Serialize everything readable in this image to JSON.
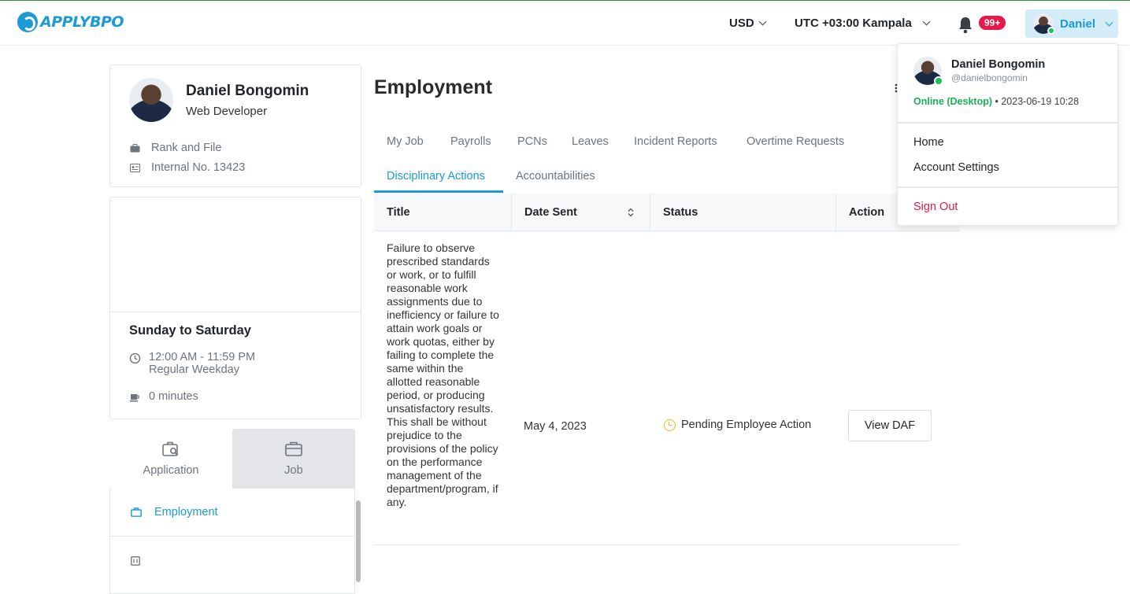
{
  "brand": {
    "name": "APPLYBPO",
    "accent": "#1a9ad6"
  },
  "topbar": {
    "currency": "USD",
    "timezone": "UTC +03:00 Kampala",
    "notifications_badge": "99+",
    "user_button": "Daniel"
  },
  "profile": {
    "name": "Daniel Bongomin",
    "role": "Web Developer",
    "rank": "Rank and File",
    "internal_no": "Internal No. 13423"
  },
  "schedule": {
    "days": "Sunday to Saturday",
    "time": "12:00 AM - 11:59 PM",
    "type": "Regular Weekday",
    "break": "0 minutes"
  },
  "left_tabs": [
    {
      "label": "Application"
    },
    {
      "label": "Job"
    }
  ],
  "side_menu": [
    {
      "label": "Employment"
    },
    {
      "label": ""
    }
  ],
  "main": {
    "title": "Employment",
    "tabs_row1": [
      "My Job",
      "Payrolls",
      "PCNs",
      "Leaves",
      "Incident Reports",
      "Overtime Requests"
    ],
    "tabs_row2": [
      "Disciplinary Actions",
      "Accountabilities"
    ],
    "active_tab": "Disciplinary Actions"
  },
  "table": {
    "columns": [
      "Title",
      "Date Sent",
      "Status",
      "Action"
    ],
    "rows": [
      {
        "title": "Failure to observe prescribed standards or work, or to fulfill reasonable work assignments due to inefficiency or failure to attain work goals or work quotas, either by failing to complete the same within the allotted reasonable period, or producing unsatisfactory results. This shall be without prejudice to the provisions of the policy on the performance management of the department/program, if any.",
        "date_sent": "May 4, 2023",
        "status": "Pending Employee Action",
        "action": "View DAF"
      }
    ]
  },
  "dropdown": {
    "name": "Daniel Bongomin",
    "handle": "@danielbongomin",
    "status": "Online (Desktop)",
    "last_seen": "• 2023-06-19 10:28",
    "items": [
      "Home",
      "Account Settings"
    ],
    "sign_out": "Sign Out"
  }
}
